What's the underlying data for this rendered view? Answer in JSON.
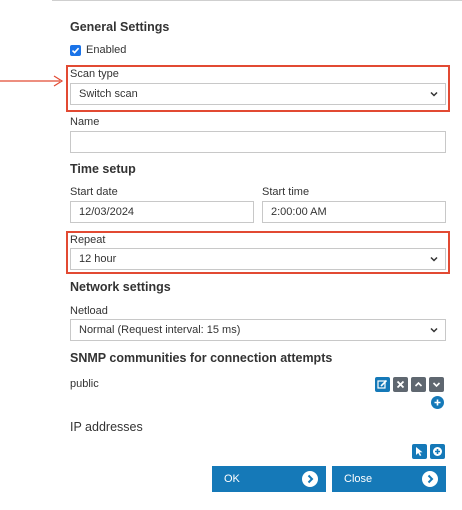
{
  "general": {
    "heading": "General Settings",
    "enabled_label": "Enabled",
    "enabled_checked": true
  },
  "scan_type": {
    "label": "Scan type",
    "value": "Switch scan"
  },
  "name": {
    "label": "Name",
    "value": ""
  },
  "time_setup": {
    "heading": "Time setup",
    "start_date_label": "Start date",
    "start_date_value": "12/03/2024",
    "start_time_label": "Start time",
    "start_time_value": "2:00:00 AM"
  },
  "repeat": {
    "label": "Repeat",
    "value": "12 hour"
  },
  "network": {
    "heading": "Network settings",
    "netload_label": "Netload",
    "netload_value": "Normal (Request interval: 15 ms)"
  },
  "snmp": {
    "heading": "SNMP communities for connection attempts",
    "communities": [
      "public"
    ]
  },
  "ip": {
    "heading": "IP addresses"
  },
  "buttons": {
    "ok_label": "OK",
    "close_label": "Close"
  },
  "colors": {
    "accent": "#1579b8",
    "highlight": "#e24a33",
    "icon_grey": "#5f6770"
  },
  "icons": [
    "check-icon",
    "chevron-down-icon",
    "edit-icon",
    "delete-icon",
    "move-up-icon",
    "move-down-icon",
    "add-icon",
    "cursor-icon",
    "arrow-right-icon"
  ]
}
